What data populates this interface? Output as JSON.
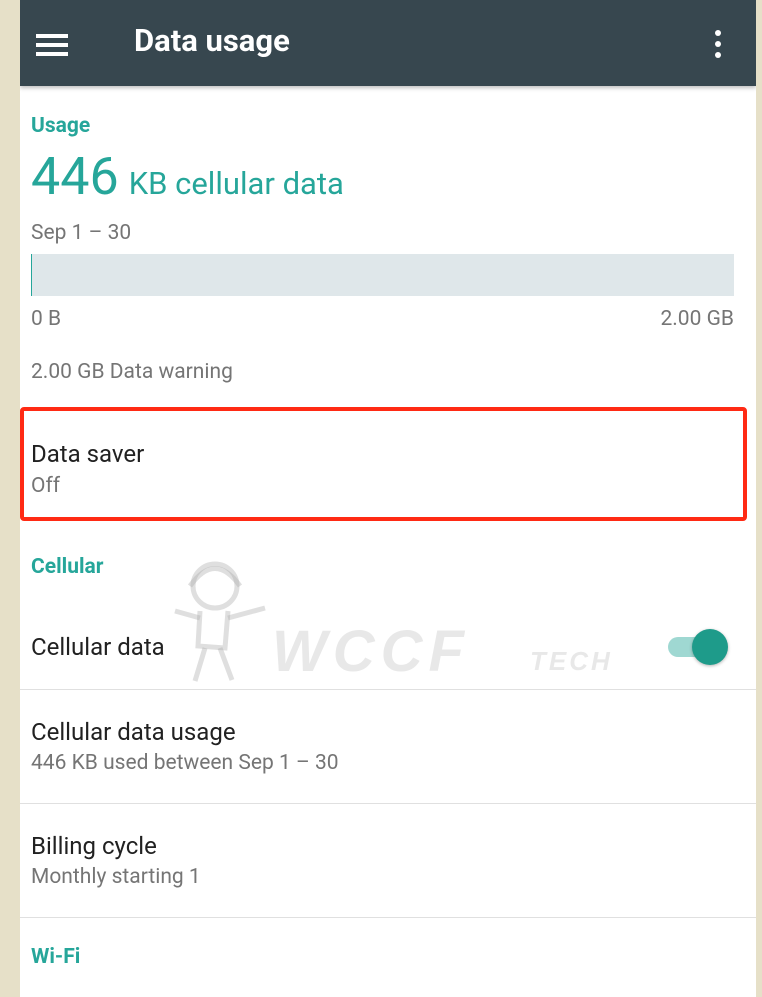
{
  "app_bar": {
    "title": "Data usage",
    "menu_icon": "hamburger-menu-icon",
    "overflow_icon": "more-vert-icon"
  },
  "usage": {
    "header": "Usage",
    "amount": "446",
    "unit_label": "KB cellular data",
    "period": "Sep 1 – 30",
    "bar_fraction": 0.0002,
    "bar_min": "0 B",
    "bar_max": "2.00 GB",
    "warning": "2.00 GB Data warning"
  },
  "data_saver": {
    "title": "Data saver",
    "status": "Off"
  },
  "cellular": {
    "header": "Cellular",
    "cellular_data": {
      "title": "Cellular data",
      "enabled": true
    },
    "data_usage": {
      "title": "Cellular data usage",
      "summary": "446 KB used between Sep 1 – 30"
    },
    "billing": {
      "title": "Billing cycle",
      "summary": "Monthly starting 1"
    }
  },
  "wifi": {
    "header": "Wi-Fi"
  },
  "watermark": {
    "text": "WCCF",
    "sub": "TECH"
  },
  "colors": {
    "accent": "#26a69a",
    "appbar": "#37474f",
    "highlight": "#ff2a14"
  }
}
